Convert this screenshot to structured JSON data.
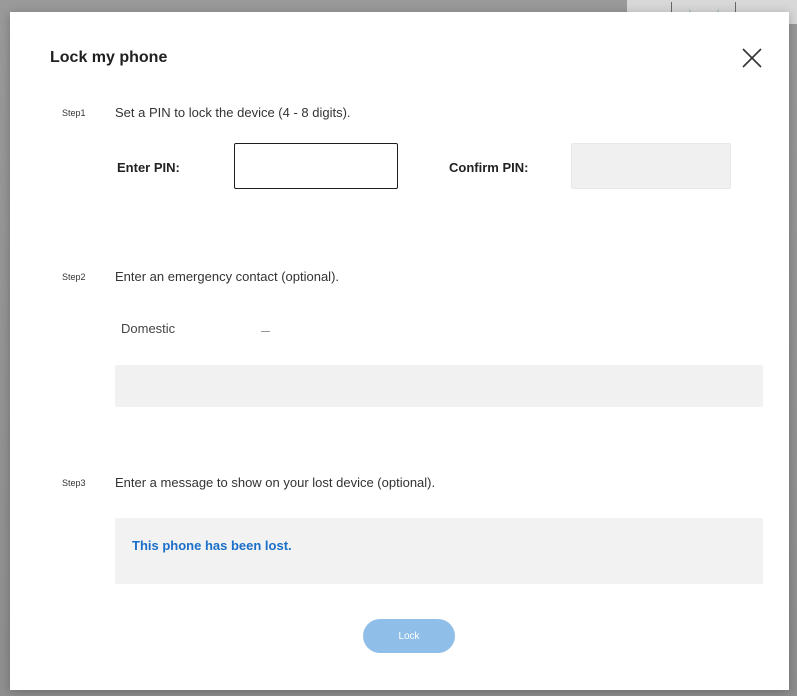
{
  "dialog": {
    "title": "Lock my phone",
    "close_icon": "close-icon"
  },
  "step1": {
    "tag": "Step1",
    "text": "Set a PIN to lock the device (4 - 8 digits).",
    "enter_pin_label": "Enter PIN:",
    "enter_pin_value": "",
    "confirm_pin_label": "Confirm PIN:",
    "confirm_pin_value": ""
  },
  "step2": {
    "tag": "Step2",
    "text": "Enter an emergency contact (optional).",
    "country_select": "Domestic",
    "phone_value": ""
  },
  "step3": {
    "tag": "Step3",
    "text": "Enter a message to show on your lost device (optional).",
    "message": "This phone has been lost."
  },
  "actions": {
    "lock_label": "Lock"
  },
  "colors": {
    "accent": "#1a6fc8",
    "button_disabled": "#8fbfe8"
  }
}
